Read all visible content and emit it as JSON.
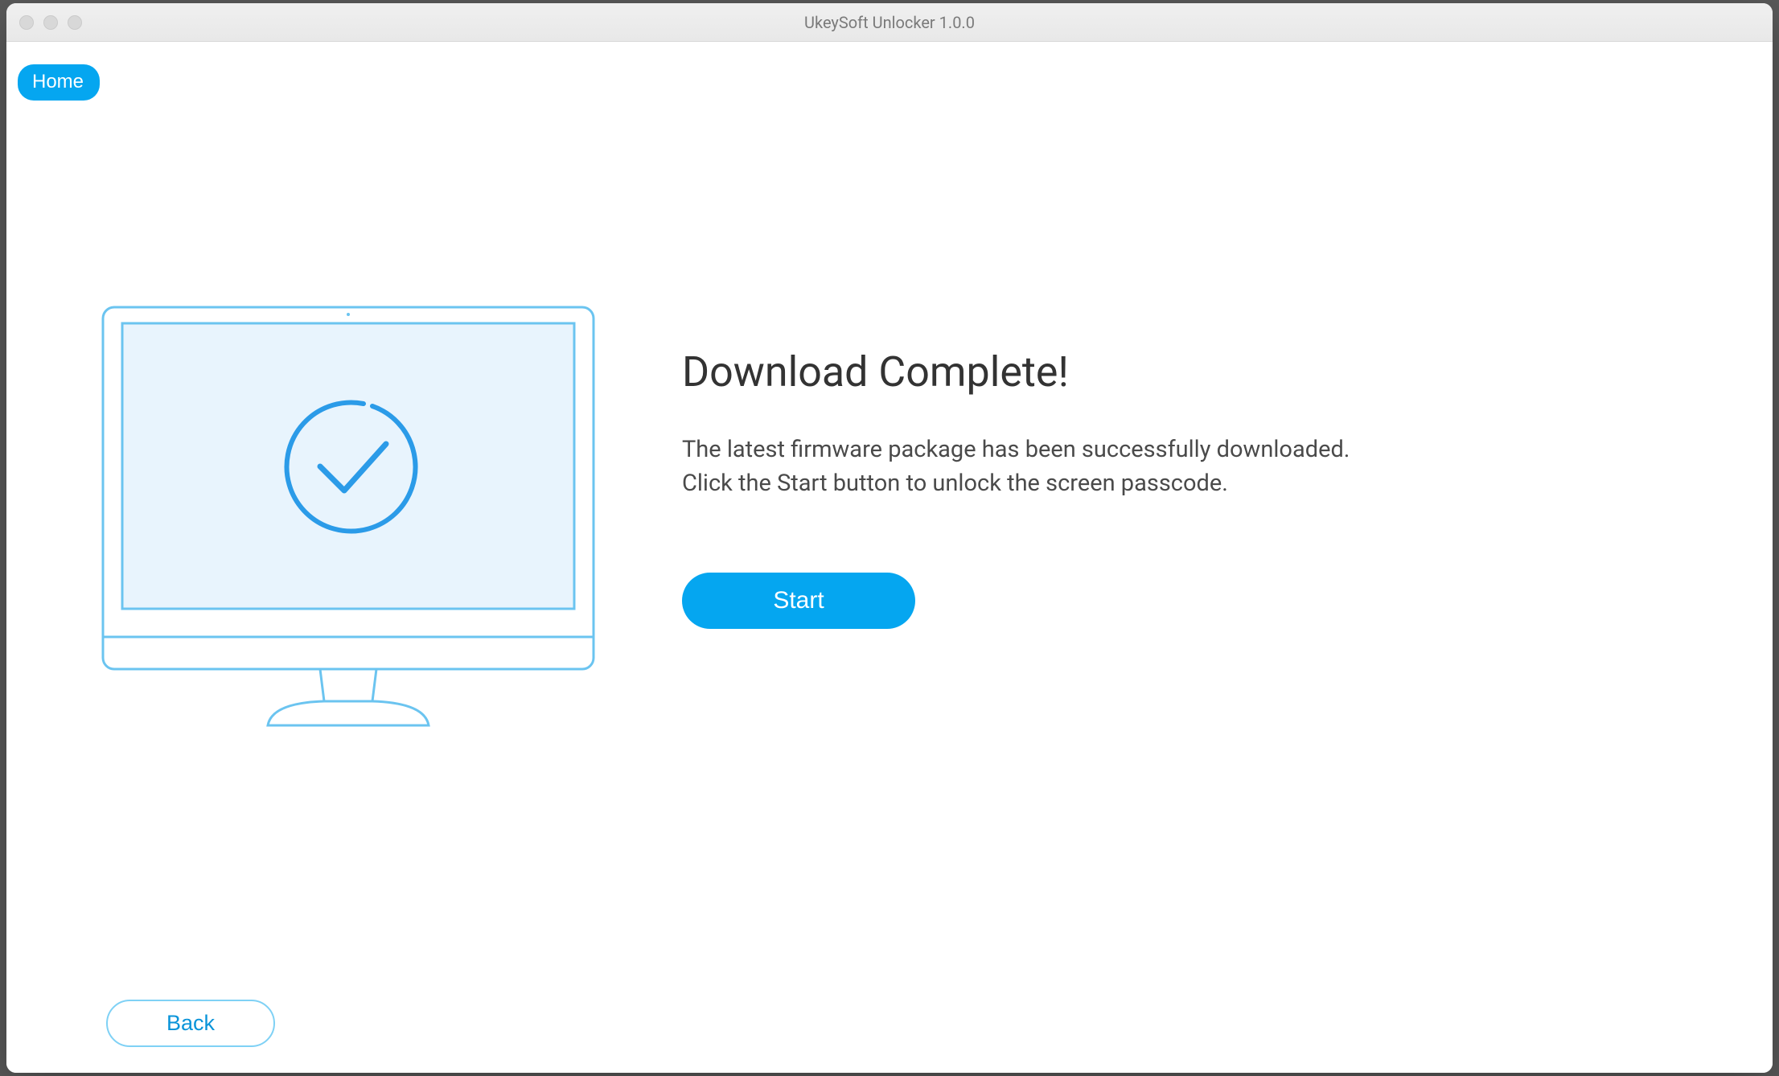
{
  "window": {
    "title": "UkeySoft Unlocker 1.0.0"
  },
  "nav": {
    "home_label": "Home"
  },
  "main": {
    "heading": "Download Complete!",
    "description_line1": "The latest firmware package has been successfully downloaded.",
    "description_line2": "Click the Start button to unlock the screen passcode.",
    "start_label": "Start"
  },
  "footer": {
    "back_label": "Back"
  }
}
